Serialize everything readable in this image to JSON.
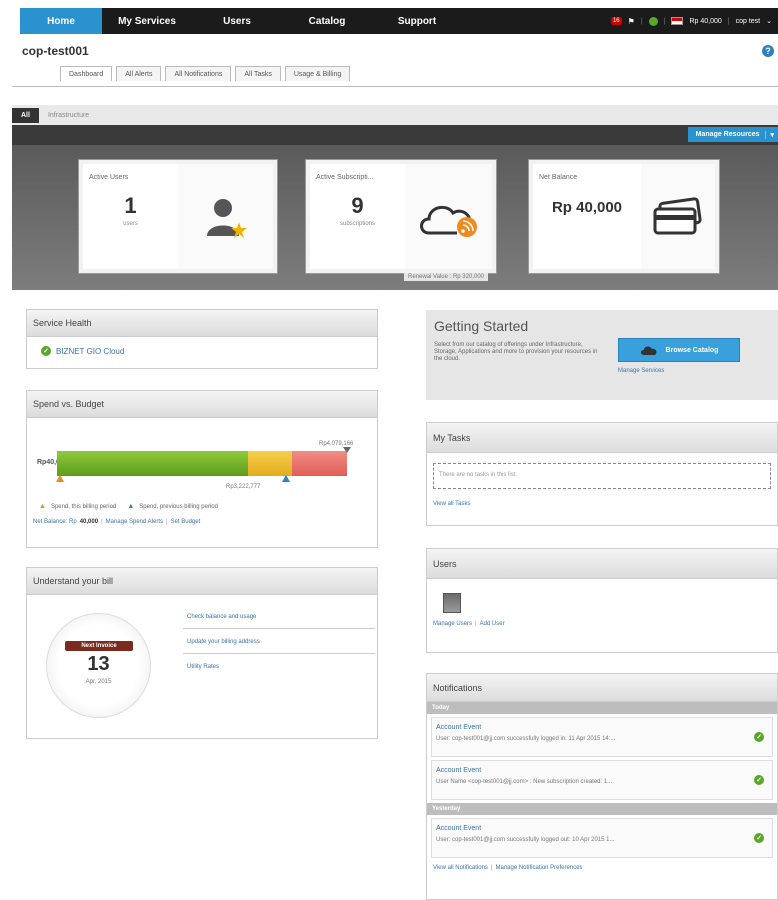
{
  "nav": {
    "items": [
      "Home",
      "My Services",
      "Users",
      "Catalog",
      "Support"
    ],
    "badge_count": "16",
    "balance": "Rp 40,000",
    "user": "cop test",
    "user_caret": "⌄"
  },
  "account_title": "cop-test001",
  "tabs": [
    "Dashboard",
    "All Alerts",
    "All Notifications",
    "All Tasks",
    "Usage & Billing"
  ],
  "filters": [
    "All",
    "Infrastructure"
  ],
  "manage_resources": "Manage Resources",
  "cards": {
    "users": {
      "title": "Active Users",
      "value": "1",
      "sub": "users"
    },
    "subs": {
      "title": "Active Subscripti...",
      "value": "9",
      "sub": "subscriptions",
      "renewal": "Renewal Value : Rp 320,000"
    },
    "balance": {
      "title": "Net Balance",
      "value": "Rp 40,000"
    }
  },
  "service_health": {
    "title": "Service Health",
    "item": "BIZNET GIO Cloud"
  },
  "spend": {
    "title": "Spend vs. Budget",
    "max_label": "Rp4,079,166",
    "current_label": "Rp40,000",
    "previous_label": "Rp3,222,777",
    "current_fraction": 0.01,
    "previous_fraction": 0.79,
    "legend_current": "Spend, this billing period",
    "legend_previous": "Spend, previous billing period",
    "net_balance_prefix": "Net Balance: Rp",
    "net_balance_value": "40,000",
    "manage_alerts": "Manage Spend Alerts",
    "set_budget": "Set Budget"
  },
  "bill": {
    "title": "Understand your bill",
    "invoice_label": "Next Invoice",
    "day": "13",
    "month": "Apr, 2015",
    "links": [
      "Check balance and usage",
      "Update your billing address",
      "Utility Rates"
    ]
  },
  "getting_started": {
    "title": "Getting Started",
    "desc": "Select from our catalog of offerings under Infrastructure, Storage, Applications and more to provision your resources in the cloud.",
    "browse": "Browse Catalog",
    "manage_services": "Manage Services"
  },
  "tasks": {
    "title": "My Tasks",
    "empty": "There are no tasks in this list.",
    "view_all": "View all Tasks"
  },
  "users_panel": {
    "title": "Users",
    "manage": "Manage Users",
    "add": "Add User"
  },
  "notifications": {
    "title": "Notifications",
    "today": "Today",
    "yesterday": "Yesterday",
    "items": [
      {
        "title": "Account Event",
        "text": "User: cop-test001@jj.com successfully logged in: 11 Apr 2015 14:..."
      },
      {
        "title": "Account Event",
        "text": "User Name <cop-test001@jj.com> : New subscription created: 1..."
      },
      {
        "title": "Account Event",
        "text": "User: cop-test001@jj.com successfully logged out: 10 Apr 2015 1..."
      }
    ],
    "view_all": "View all Notifications",
    "manage_prefs": "Manage Notification Preferences"
  }
}
